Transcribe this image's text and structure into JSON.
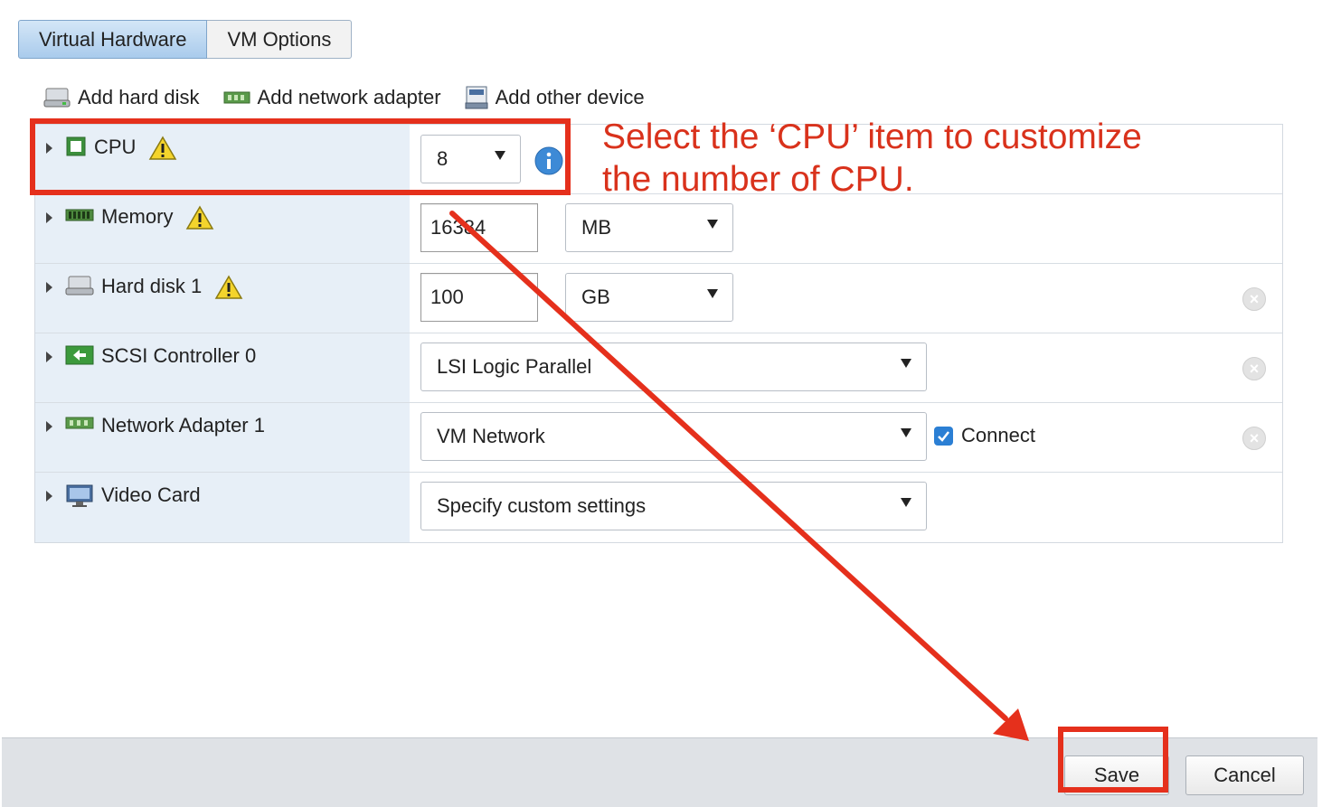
{
  "tabs": [
    {
      "label": "Virtual Hardware",
      "active": true
    },
    {
      "label": "VM Options",
      "active": false
    }
  ],
  "toolbar": {
    "add_hard_disk": "Add hard disk",
    "add_network_adapter": "Add network adapter",
    "add_other_device": "Add other device"
  },
  "hardware": {
    "cpu": {
      "label": "CPU",
      "value": "8"
    },
    "memory": {
      "label": "Memory",
      "value": "16384",
      "unit": "MB"
    },
    "hard_disk": {
      "label": "Hard disk 1",
      "value": "100",
      "unit": "GB"
    },
    "scsi": {
      "label": "SCSI Controller 0",
      "value": "LSI Logic Parallel"
    },
    "network": {
      "label": "Network Adapter 1",
      "value": "VM Network",
      "connect_label": "Connect",
      "connected": true
    },
    "video": {
      "label": "Video Card",
      "value": "Specify custom settings"
    }
  },
  "annotation": {
    "line1": "Select the ‘CPU’ item to customize",
    "line2": "the number of CPU."
  },
  "footer": {
    "save_label": "Save",
    "cancel_label": "Cancel"
  },
  "colors": {
    "annotation_red": "#e5301c",
    "tab_active": "#a9cbec",
    "label_bg": "#e7eff7",
    "checkbox_blue": "#2b7fd4"
  },
  "icons": [
    "hard-disk-icon",
    "network-adapter-icon",
    "other-device-icon",
    "cpu-chip-icon",
    "warning-icon",
    "memory-icon",
    "scsi-controller-icon",
    "video-card-icon",
    "info-icon",
    "remove-icon",
    "checkmark-icon"
  ]
}
